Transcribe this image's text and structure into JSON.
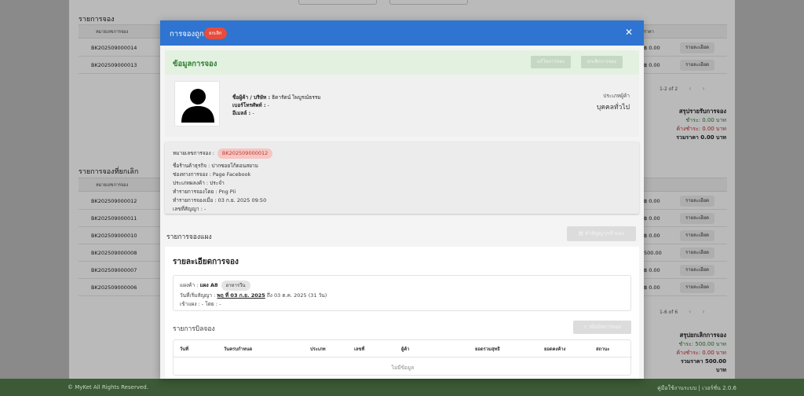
{
  "background": {
    "section_active": "รายการจอง",
    "section_cancelled": "รายการจองที่ยกเลิก",
    "col_code": "หมายเลขการจอง",
    "col_price": "ราคา",
    "active_rows": [
      {
        "code": "BK202509000014",
        "price": "฿ 0.00",
        "detail": "รายละเอียด"
      },
      {
        "code": "BK202509000013",
        "price": "฿ 0.00",
        "detail": "รายละเอียด"
      }
    ],
    "active_pager": "1-2 of 2",
    "active_summary": {
      "title": "สรุปรายรับการจอง",
      "paid": "ชำระ: 0.00 บาท",
      "owe": "ค้างชำระ: 0.00 บาท",
      "total": "รวมราคา 0.00 บาท"
    },
    "cancelled_rows": [
      {
        "code": "BK202509000012",
        "price": "฿ 0.00",
        "detail": "รายละเอียด"
      },
      {
        "code": "BK202509000011",
        "price": "฿ 0.00",
        "detail": "รายละเอียด"
      },
      {
        "code": "BK202509000010",
        "price": "฿ 0.00",
        "detail": "รายละเอียด"
      },
      {
        "code": "BK202509000008",
        "price": "500.00",
        "detail": "รายละเอียด"
      },
      {
        "code": "BK202509000007",
        "price": "฿ 0.00",
        "detail": "รายละเอียด"
      },
      {
        "code": "BK202509000006",
        "price": "฿ 0.00",
        "detail": "รายละเอียด"
      }
    ],
    "cancelled_pager": "1-6 of 6",
    "cancelled_summary": {
      "title": "สรุปยกเลิกการจอง",
      "paid": "ชำระ: 500.00 บาท",
      "owe": "ค้างชำระ: 0.00 บาท",
      "total": "รวมราคา 500.00 บาท"
    }
  },
  "footer": {
    "copyright": "© MyKet All Rights Reserved.",
    "right": "คู่มือใช้งานระบบ | เวอร์ชั่น 2.0.6"
  },
  "modal": {
    "title": "การจองถูก",
    "status_badge": "ยกเลิก",
    "booking_info_title": "ข้อมูลการจอง",
    "edit_button": "แก้ไขการจอง",
    "cancel_button": "ยกเลิกการจอง",
    "customer_label": "ชื่อผู้ค้า / บริษัท :",
    "customer_value": "ธิดารัตน์ ไพบูรณ์ธรรม",
    "phone_label": "เบอร์โทรศัพท์ :",
    "phone_value": "-",
    "email_label": "อีเมลล์ :",
    "email_value": "-",
    "customer_type_label": "ประเภทผู้ค้า",
    "customer_type_value": "บุคคลทั่วไป",
    "booking_no_label": "หมายเลขการจอง :",
    "booking_no_value": "BK202509000012",
    "shop_name": "ชื่อร้านค้าธุรกิจ : ปากซอยโก้ดอนสยาม",
    "channel": "ช่องทางการจอง : Page Facebook",
    "product_type": "ประเภทผลงค้า : ประจำ",
    "made_by": "ทำรายการจองโดย : Png Pii",
    "made_at": "ทำรายการจองเมื่อ : 03 ก.ย. 2025 09:50",
    "contract_no": "เลขที่สัญญา : -",
    "stall_list_title": "รายการจองแผง",
    "contract_button": "ทำสัญญา/เข้าแผง",
    "reservation_detail_title": "รายละเอียดการจอง",
    "stall_label": "แผงค้า :",
    "stall_value": "แผง A8",
    "stall_tag": "อาหารวีน",
    "contract_start_prefix": "วันที่เริ่มสัญญา :",
    "contract_start_value": "พฤ ที่ 03 ก.ย. 2025",
    "contract_end": "ถึง 03 ต.ค. 2025 (31 วัน)",
    "enter_stall": "เข้าแผง : - โดย : -",
    "bill_list_title": "รายการบิลจอง",
    "add_bill_button": "+ เพิ่มบิลการจอง",
    "bill_columns": [
      "วันที่",
      "วันครบกำหนด",
      "ประเภท",
      "เลขที่",
      "ผู้ค้า",
      "ยอดรวมสุทธิ",
      "ยอดคงค้าง",
      "สถานะ"
    ],
    "bill_empty": "ไม่มีข้อมูล"
  }
}
